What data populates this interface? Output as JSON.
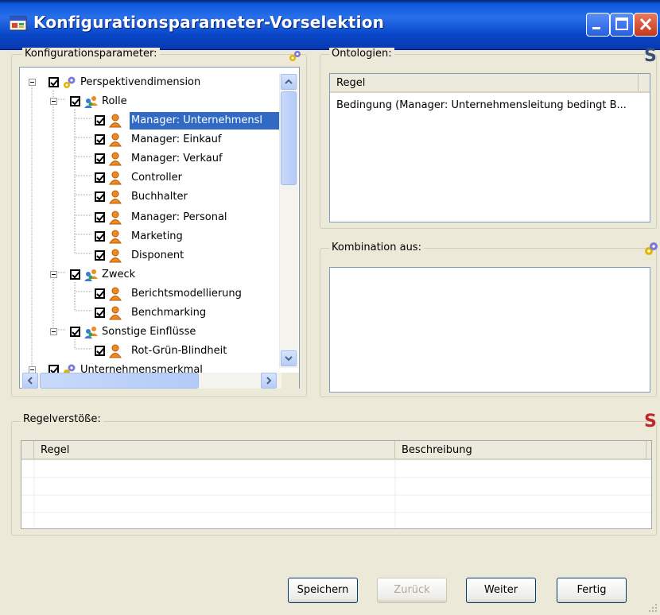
{
  "window": {
    "title": "Konfigurationsparameter-Vorselektion",
    "controls": [
      "minimize-icon",
      "maximize-icon",
      "close-icon"
    ]
  },
  "config_group": {
    "label": "Konfigurationsparameter:",
    "tree": [
      {
        "label": "Perspektivendimension",
        "level": 0,
        "expanded": true,
        "checked": true,
        "icon": "gears-icon"
      },
      {
        "label": "Rolle",
        "level": 1,
        "expanded": true,
        "checked": true,
        "icon": "group-icon"
      },
      {
        "label": "Manager: Unternehmensl",
        "level": 2,
        "checked": true,
        "icon": "user-icon",
        "selected": true
      },
      {
        "label": "Manager: Einkauf",
        "level": 2,
        "checked": true,
        "icon": "user-icon"
      },
      {
        "label": "Manager: Verkauf",
        "level": 2,
        "checked": true,
        "icon": "user-icon"
      },
      {
        "label": "Controller",
        "level": 2,
        "checked": true,
        "icon": "user-icon"
      },
      {
        "label": "Buchhalter",
        "level": 2,
        "checked": true,
        "icon": "user-icon"
      },
      {
        "label": "Manager: Personal",
        "level": 2,
        "checked": true,
        "icon": "user-icon"
      },
      {
        "label": "Marketing",
        "level": 2,
        "checked": true,
        "icon": "user-icon"
      },
      {
        "label": "Disponent",
        "level": 2,
        "checked": true,
        "icon": "user-icon"
      },
      {
        "label": "Zweck",
        "level": 1,
        "expanded": true,
        "checked": true,
        "icon": "group-icon"
      },
      {
        "label": "Berichtsmodellierung",
        "level": 2,
        "checked": true,
        "icon": "user-icon"
      },
      {
        "label": "Benchmarking",
        "level": 2,
        "checked": true,
        "icon": "user-icon"
      },
      {
        "label": "Sonstige Einflüsse",
        "level": 1,
        "expanded": true,
        "checked": true,
        "icon": "group-icon"
      },
      {
        "label": "Rot-Grün-Blindheit",
        "level": 2,
        "checked": true,
        "icon": "user-icon"
      },
      {
        "label": "Unternehmensmerkmal",
        "level": 0,
        "expanded": false,
        "checked": true,
        "icon": "gears-icon"
      }
    ]
  },
  "ontology_group": {
    "label": "Ontologien:",
    "column": "Regel",
    "rows": [
      "Bedingung (Manager: Unternehmensleitung bedingt B..."
    ]
  },
  "combination_group": {
    "label": "Kombination aus:"
  },
  "violations_group": {
    "label": "Regelverstöße:",
    "columns": [
      "Regel",
      "Beschreibung"
    ]
  },
  "buttons": {
    "save": "Speichern",
    "back": "Zurück",
    "next": "Weiter",
    "finish": "Fertig"
  },
  "colors": {
    "titlebar": "#0a58e0",
    "selection": "#316ac5",
    "rule_icon": "#c0262b",
    "ontology_icon": "#3a4f7a"
  }
}
